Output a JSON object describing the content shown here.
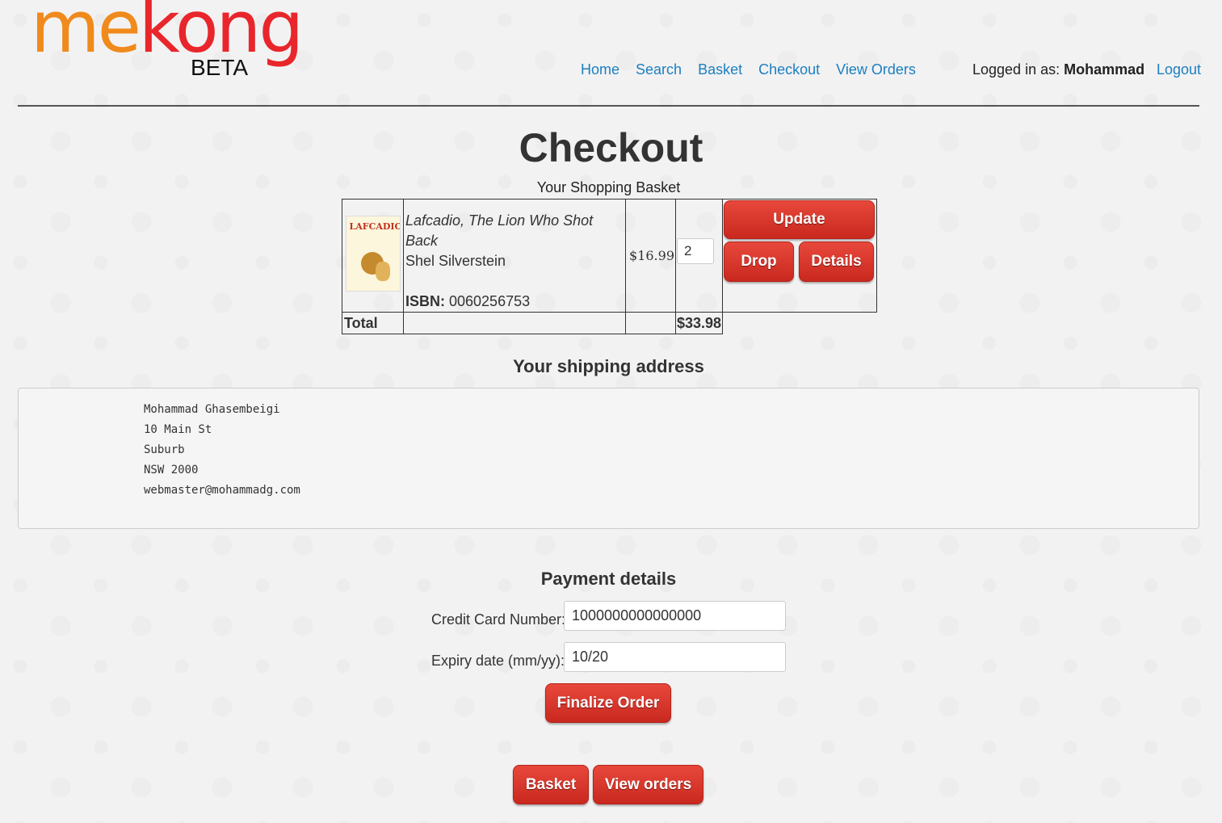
{
  "brand": {
    "logo_me": "me",
    "logo_kong": "kong",
    "logo_beta": "BETA"
  },
  "nav": {
    "items": [
      "Home",
      "Search",
      "Basket",
      "Checkout",
      "View Orders"
    ],
    "logged_in_prefix": "Logged in as: ",
    "user_name": "Mohammad",
    "logout_label": "Logout"
  },
  "page": {
    "title": "Checkout",
    "basket_caption": "Your Shopping Basket"
  },
  "basket": {
    "items": [
      {
        "cover_text": "LAFCADIO",
        "title": "Lafcadio, The Lion Who Shot Back",
        "author": "Shel Silverstein",
        "isbn_label": "ISBN:",
        "isbn": " 0060256753",
        "price": "$16.99",
        "quantity": "2",
        "update_label": "Update",
        "drop_label": "Drop",
        "details_label": "Details"
      }
    ],
    "total_label": "Total",
    "total_amount": "$33.98"
  },
  "shipping": {
    "heading": "Your shipping address",
    "name": "Mohammad Ghasembeigi",
    "street": "10 Main St",
    "suburb": "Suburb",
    "state_postcode": "NSW 2000",
    "email": "webmaster@mohammadg.com"
  },
  "payment": {
    "heading": "Payment details",
    "card_label": "Credit Card Number:",
    "card_value": "1000000000000000",
    "expiry_label": "Expiry date (mm/yy):",
    "expiry_value": "10/20",
    "finalize_label": "Finalize Order"
  },
  "footer_buttons": {
    "basket_label": "Basket",
    "view_orders_label": "View orders"
  },
  "colors": {
    "accent_orange": "#f08a1c",
    "accent_red": "#e8262b",
    "link_blue": "#1a7fc2",
    "button_red": "#d7362b"
  }
}
